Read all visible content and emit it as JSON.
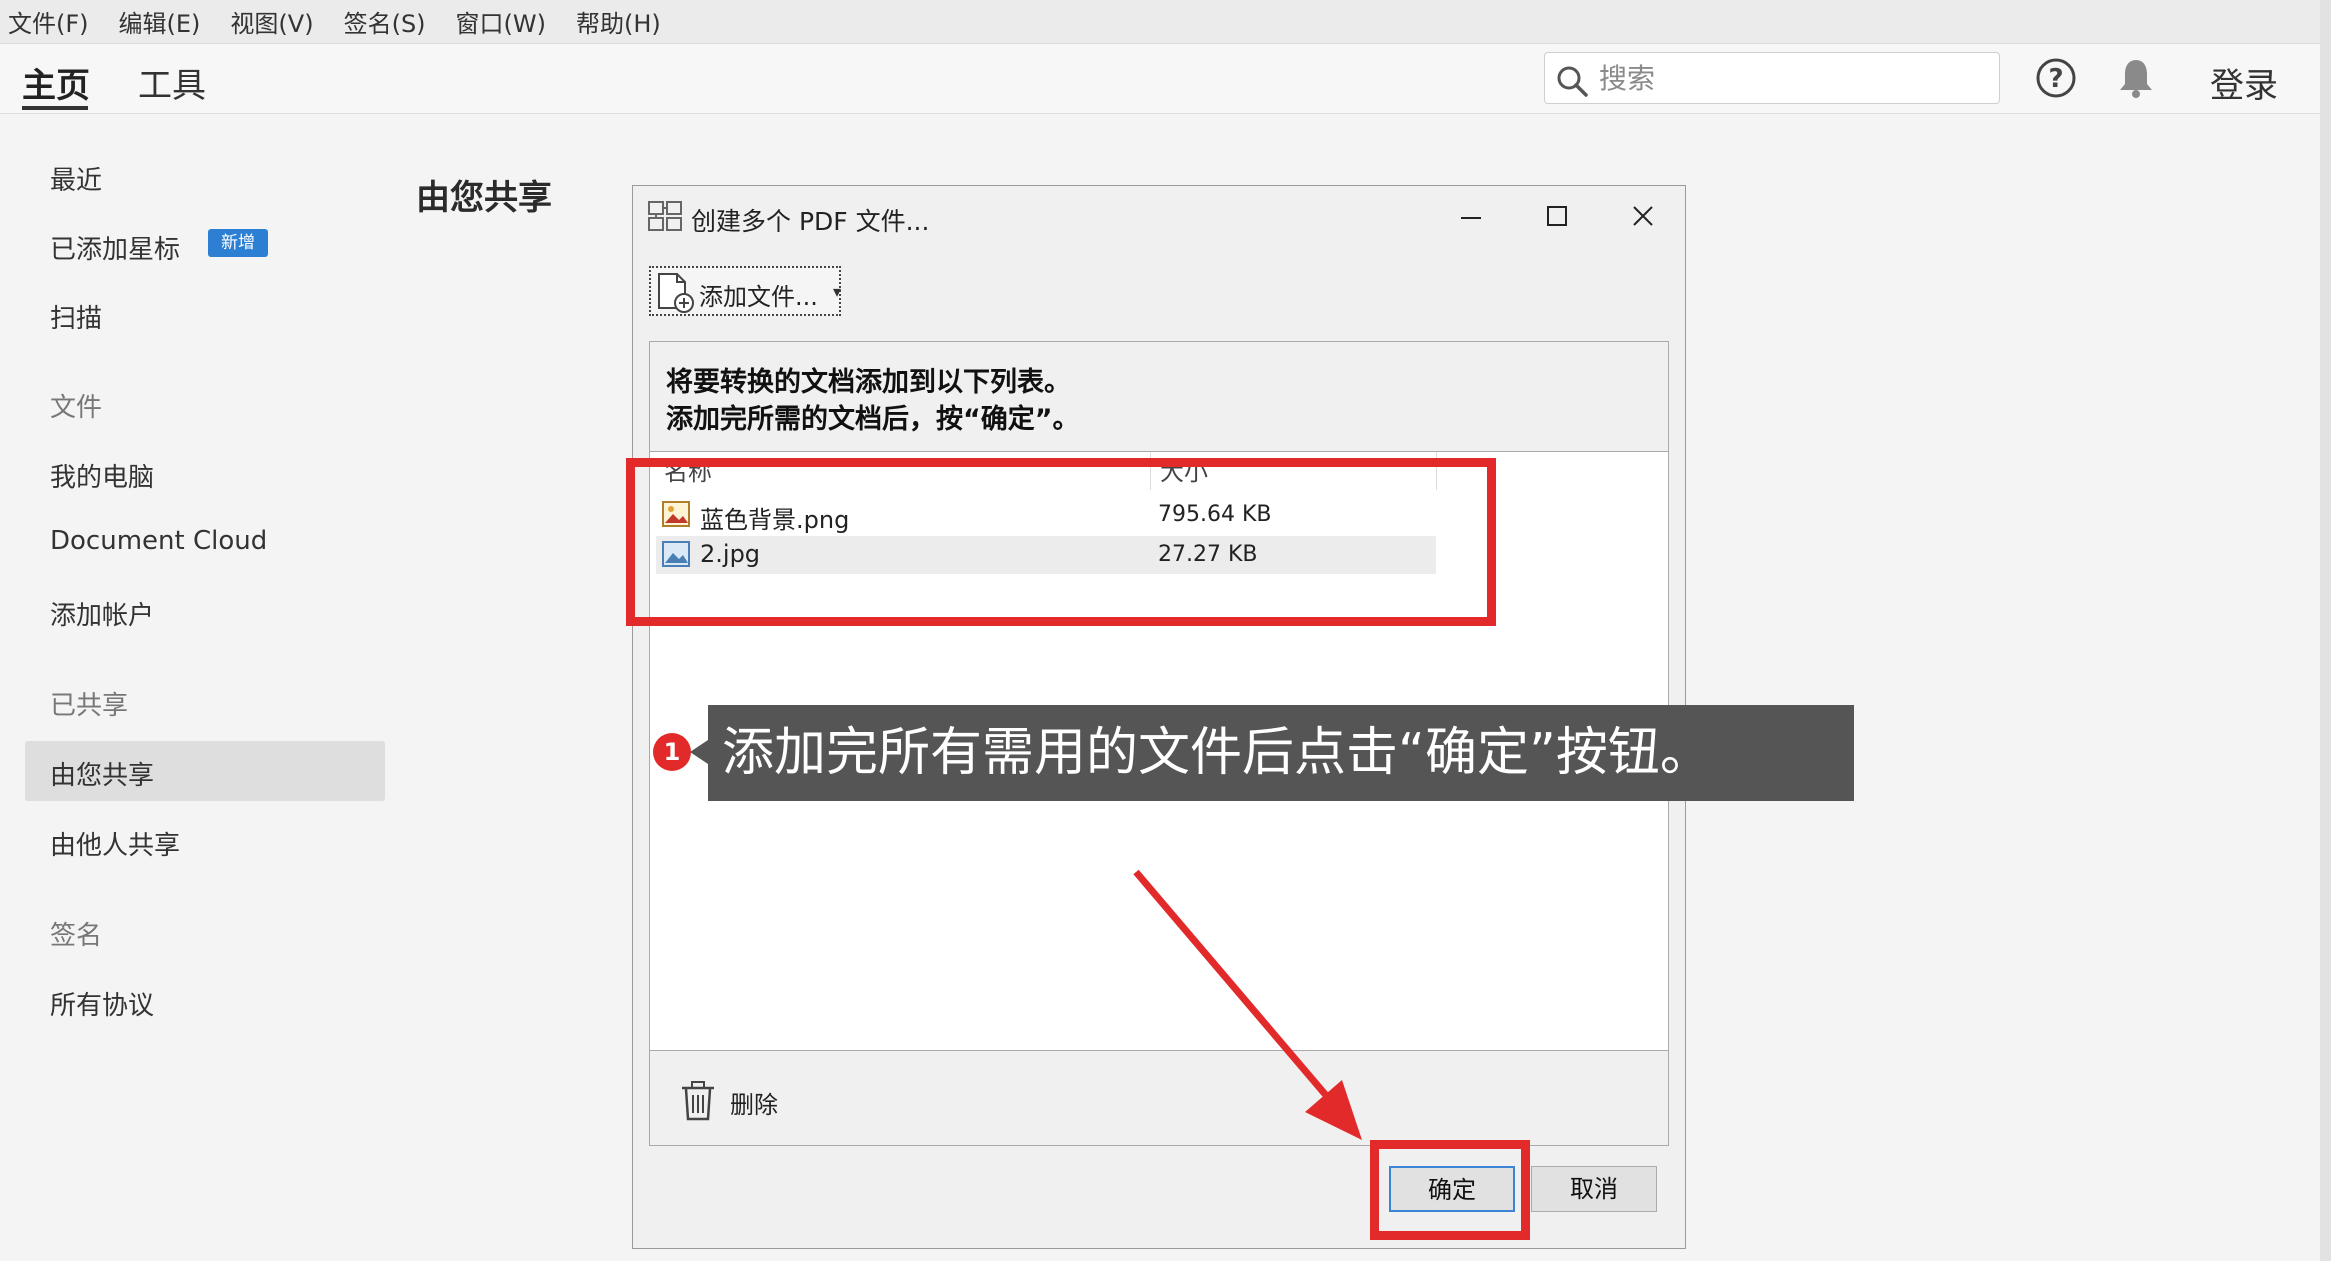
{
  "menu": [
    "文件(F)",
    "编辑(E)",
    "视图(V)",
    "签名(S)",
    "窗口(W)",
    "帮助(H)"
  ],
  "topbar": {
    "tabs": [
      "主页",
      "工具"
    ],
    "search_placeholder": "搜索",
    "login": "登录",
    "icons": [
      "search-icon",
      "help-icon",
      "bell-icon"
    ]
  },
  "sidebar": {
    "recent": "最近",
    "starred": "已添加星标",
    "starred_badge": "新增",
    "scan": "扫描",
    "files_group": "文件",
    "my_computer": "我的电脑",
    "document_cloud": "Document Cloud",
    "add_account": "添加帐户",
    "shared_group": "已共享",
    "shared_by_you": "由您共享",
    "shared_by_others": "由他人共享",
    "sign_group": "签名",
    "all_agreements": "所有协议"
  },
  "main": {
    "title": "由您共享"
  },
  "dialog": {
    "title": "创建多个 PDF 文件...",
    "add_files_label": "添加文件...",
    "instruction_line1": "将要转换的文档添加到以下列表。",
    "instruction_line2": "添加完所需的文档后，按“确定”。",
    "columns": {
      "name": "名称",
      "size": "大小"
    },
    "files": [
      {
        "name": "蓝色背景.png",
        "size": "795.64 KB",
        "icon": "png-file-icon"
      },
      {
        "name": "2.jpg",
        "size": "27.27 KB",
        "icon": "jpg-file-icon"
      }
    ],
    "delete_label": "删除",
    "ok_label": "确定",
    "cancel_label": "取消"
  },
  "annotation": {
    "step": "1",
    "callout": "添加完所有需用的文件后点击“确定”按钮。",
    "highlight_color": "#e32a2a"
  }
}
